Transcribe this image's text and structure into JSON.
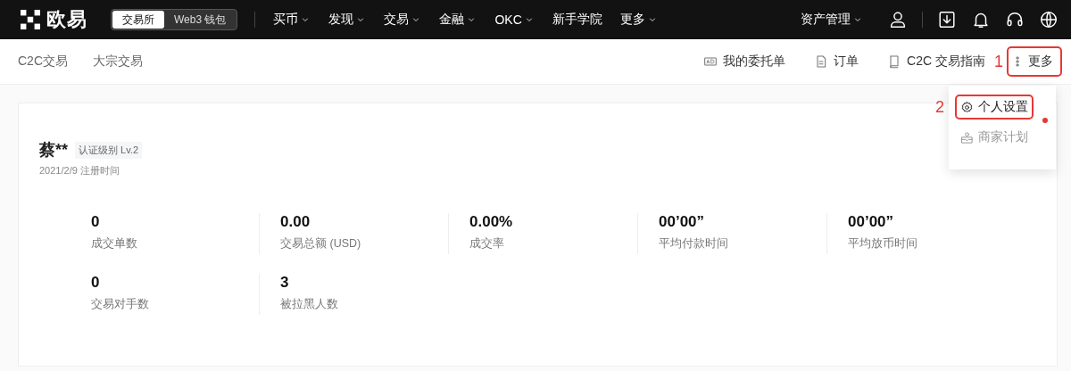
{
  "top_nav": {
    "logo": "欧易",
    "switch": [
      {
        "label": "交易所",
        "selected": true
      },
      {
        "label": "Web3 钱包",
        "selected": false
      }
    ],
    "menu": [
      {
        "label": "买币",
        "dropdown": true
      },
      {
        "label": "发现",
        "dropdown": true
      },
      {
        "label": "交易",
        "dropdown": true
      },
      {
        "label": "金融",
        "dropdown": true
      },
      {
        "label": "OKC",
        "dropdown": true
      },
      {
        "label": "新手学院",
        "dropdown": false
      },
      {
        "label": "更多",
        "dropdown": true
      }
    ],
    "asset_menu": "资产管理"
  },
  "sub_nav": {
    "tabs": [
      "C2C交易",
      "大宗交易"
    ],
    "actions": [
      {
        "kind": "ad",
        "label": "我的委托单"
      },
      {
        "kind": "doc",
        "label": "订单"
      },
      {
        "kind": "book",
        "label": "C2C 交易指南"
      }
    ],
    "more": {
      "label": "更多",
      "annotation": "1"
    }
  },
  "profile": {
    "name": "蔡**",
    "level_badge": "认证级别 Lv.2",
    "registered": "2021/2/9 注册时间",
    "stats": [
      {
        "value": "0",
        "label": "成交单数"
      },
      {
        "value": "0.00",
        "label": "交易总额 (USD)"
      },
      {
        "value": "0.00%",
        "label": "成交率"
      },
      {
        "value": "00’00”",
        "label": "平均付款时间"
      },
      {
        "value": "00’00”",
        "label": "平均放币时间"
      },
      {
        "value": "0",
        "label": "交易对手数"
      },
      {
        "value": "3",
        "label": "被拉黑人数"
      }
    ]
  },
  "more_menu": [
    {
      "kind": "settings",
      "label": "个人设置",
      "selected": true,
      "dot": false,
      "annotation": "2"
    },
    {
      "kind": "merchant",
      "label": "商家计划",
      "selected": false,
      "dot": true
    }
  ]
}
